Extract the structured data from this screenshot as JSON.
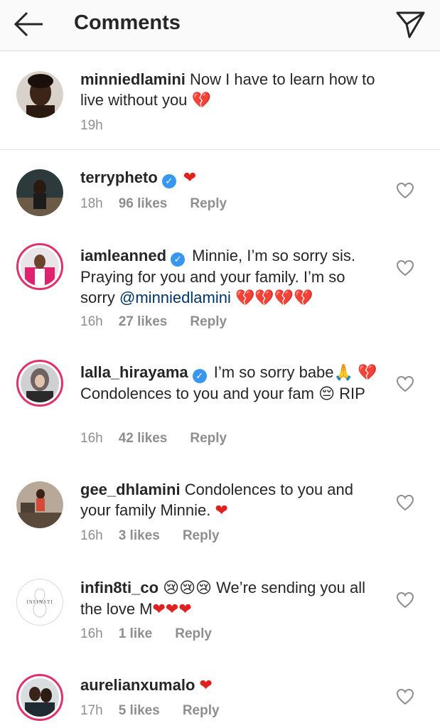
{
  "header": {
    "title": "Comments"
  },
  "caption": {
    "username": "minniedlamini",
    "text": "Now I have to learn how to live without you",
    "emoji": "💔",
    "time": "19h"
  },
  "comments": [
    {
      "username": "terrypheto",
      "verified": true,
      "text": "",
      "heart": "❤",
      "time": "18h",
      "likes": "96 likes",
      "reply": "Reply"
    },
    {
      "username": "iamleanned",
      "verified": true,
      "text": "Minnie, I’m so sorry sis. Praying for you and your family. I’m so sorry",
      "mention": "@minniedlamini",
      "emoji": "💔💔💔💔",
      "time": "16h",
      "likes": "27 likes",
      "reply": "Reply"
    },
    {
      "username": "lalla_hirayama",
      "verified": true,
      "text_a": "I’m so sorry babe",
      "emoji_a": "🙏",
      "emoji_b": "💔",
      "text_b": "Condolences to you and your fam",
      "emoji_c": "😔",
      "text_c": "RIP",
      "time": "16h",
      "likes": "42 likes",
      "reply": "Reply"
    },
    {
      "username": "gee_dhlamini",
      "verified": false,
      "text": "Condolences to you and your family Minnie.",
      "heart": "❤",
      "time": "16h",
      "likes": "3 likes",
      "reply": "Reply"
    },
    {
      "username": "infin8ti_co",
      "verified": false,
      "emoji": "😢😢😢",
      "text": "We’re sending you all the love M",
      "heart": "❤❤❤",
      "time": "16h",
      "likes": "1 like",
      "reply": "Reply",
      "avatar_text": "INFINSTI"
    },
    {
      "username": "aurelianxumalo",
      "verified": false,
      "text": "",
      "heart": "❤",
      "time": "17h",
      "likes": "5 likes",
      "reply": "Reply"
    }
  ]
}
